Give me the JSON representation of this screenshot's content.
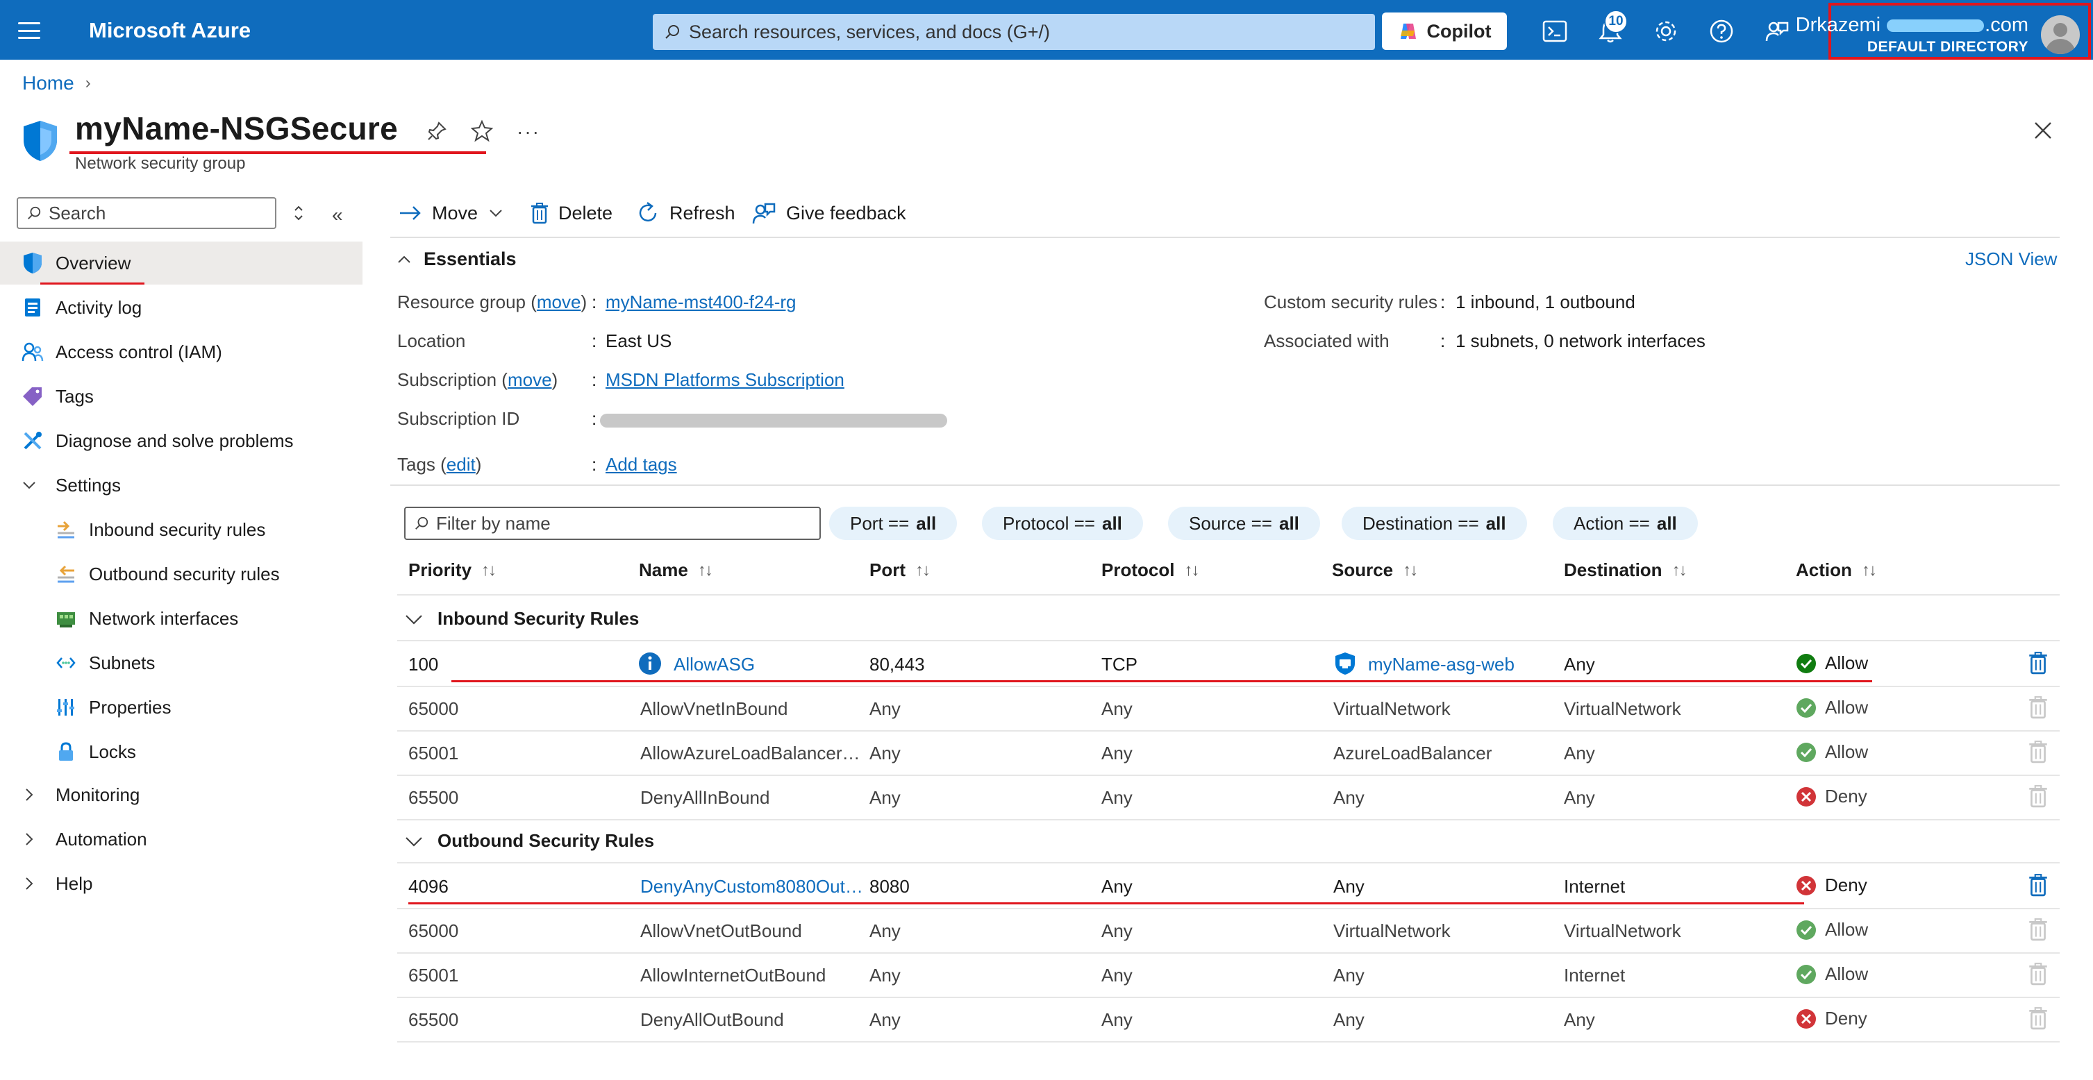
{
  "topbar": {
    "brand": "Microsoft Azure",
    "search_placeholder": "Search resources, services, and docs (G+/)",
    "copilot_label": "Copilot",
    "notification_count": "10",
    "account_name": "Drkazemi.com",
    "account_name_prefix": "Drkazemi",
    "account_name_suffix": "com",
    "account_directory": "DEFAULT DIRECTORY"
  },
  "breadcrumb": {
    "home": "Home"
  },
  "title": {
    "name": "myName-NSGSecure",
    "subtitle": "Network security group"
  },
  "sidebar": {
    "search_placeholder": "Search",
    "items": [
      {
        "label": "Overview",
        "icon": "shield-icon",
        "active": true
      },
      {
        "label": "Activity log",
        "icon": "log-icon"
      },
      {
        "label": "Access control (IAM)",
        "icon": "people-icon"
      },
      {
        "label": "Tags",
        "icon": "tag-icon"
      },
      {
        "label": "Diagnose and solve problems",
        "icon": "wrench-icon"
      },
      {
        "label": "Settings",
        "icon": "chevron-down-icon",
        "expanded": true
      },
      {
        "label": "Inbound security rules",
        "icon": "inbound-icon"
      },
      {
        "label": "Outbound security rules",
        "icon": "outbound-icon"
      },
      {
        "label": "Network interfaces",
        "icon": "nic-icon"
      },
      {
        "label": "Subnets",
        "icon": "subnet-icon"
      },
      {
        "label": "Properties",
        "icon": "properties-icon"
      },
      {
        "label": "Locks",
        "icon": "lock-icon"
      },
      {
        "label": "Monitoring",
        "icon": "chevron-right-icon"
      },
      {
        "label": "Automation",
        "icon": "chevron-right-icon"
      },
      {
        "label": "Help",
        "icon": "chevron-right-icon"
      }
    ]
  },
  "toolbar": {
    "move": "Move",
    "delete": "Delete",
    "refresh": "Refresh",
    "feedback": "Give feedback"
  },
  "essentials": {
    "header": "Essentials",
    "json_view": "JSON View",
    "resource_group_label": "Resource group",
    "move_link": "move",
    "resource_group_value": "myName-mst400-f24-rg",
    "location_label": "Location",
    "location_value": "East US",
    "subscription_label": "Subscription",
    "subscription_value": "MSDN Platforms Subscription",
    "subscription_id_label": "Subscription ID",
    "tags_label": "Tags",
    "edit_link": "edit",
    "tags_value": "Add tags",
    "custom_rules_label": "Custom security rules",
    "custom_rules_value": "1 inbound, 1 outbound",
    "associated_label": "Associated with",
    "associated_value": "1 subnets, 0 network interfaces",
    "separator": ":"
  },
  "filters": {
    "placeholder": "Filter by name",
    "pills": [
      {
        "key": "Port ==",
        "val": "all"
      },
      {
        "key": "Protocol ==",
        "val": "all"
      },
      {
        "key": "Source ==",
        "val": "all"
      },
      {
        "key": "Destination ==",
        "val": "all"
      },
      {
        "key": "Action ==",
        "val": "all"
      }
    ]
  },
  "table": {
    "columns": [
      "Priority",
      "Name",
      "Port",
      "Protocol",
      "Source",
      "Destination",
      "Action"
    ],
    "inbound_group": "Inbound Security Rules",
    "outbound_group": "Outbound Security Rules",
    "inbound": [
      {
        "priority": "100",
        "name": "AllowASG",
        "port": "80,443",
        "protocol": "TCP",
        "source": "myName-asg-web",
        "destination": "Any",
        "action": "Allow"
      },
      {
        "priority": "65000",
        "name": "AllowVnetInBound",
        "port": "Any",
        "protocol": "Any",
        "source": "VirtualNetwork",
        "destination": "VirtualNetwork",
        "action": "Allow"
      },
      {
        "priority": "65001",
        "name": "AllowAzureLoadBalancerI…",
        "port": "Any",
        "protocol": "Any",
        "source": "AzureLoadBalancer",
        "destination": "Any",
        "action": "Allow"
      },
      {
        "priority": "65500",
        "name": "DenyAllInBound",
        "port": "Any",
        "protocol": "Any",
        "source": "Any",
        "destination": "Any",
        "action": "Deny"
      }
    ],
    "outbound": [
      {
        "priority": "4096",
        "name": "DenyAnyCustom8080Out…",
        "port": "8080",
        "protocol": "Any",
        "source": "Any",
        "destination": "Internet",
        "action": "Deny"
      },
      {
        "priority": "65000",
        "name": "AllowVnetOutBound",
        "port": "Any",
        "protocol": "Any",
        "source": "VirtualNetwork",
        "destination": "VirtualNetwork",
        "action": "Allow"
      },
      {
        "priority": "65001",
        "name": "AllowInternetOutBound",
        "port": "Any",
        "protocol": "Any",
        "source": "Any",
        "destination": "Internet",
        "action": "Allow"
      },
      {
        "priority": "65500",
        "name": "DenyAllOutBound",
        "port": "Any",
        "protocol": "Any",
        "source": "Any",
        "destination": "Any",
        "action": "Deny"
      }
    ]
  },
  "colors": {
    "brand": "#0f6cbd",
    "allow": "#107c10",
    "deny": "#d13438",
    "highlight": "#e0161e"
  }
}
